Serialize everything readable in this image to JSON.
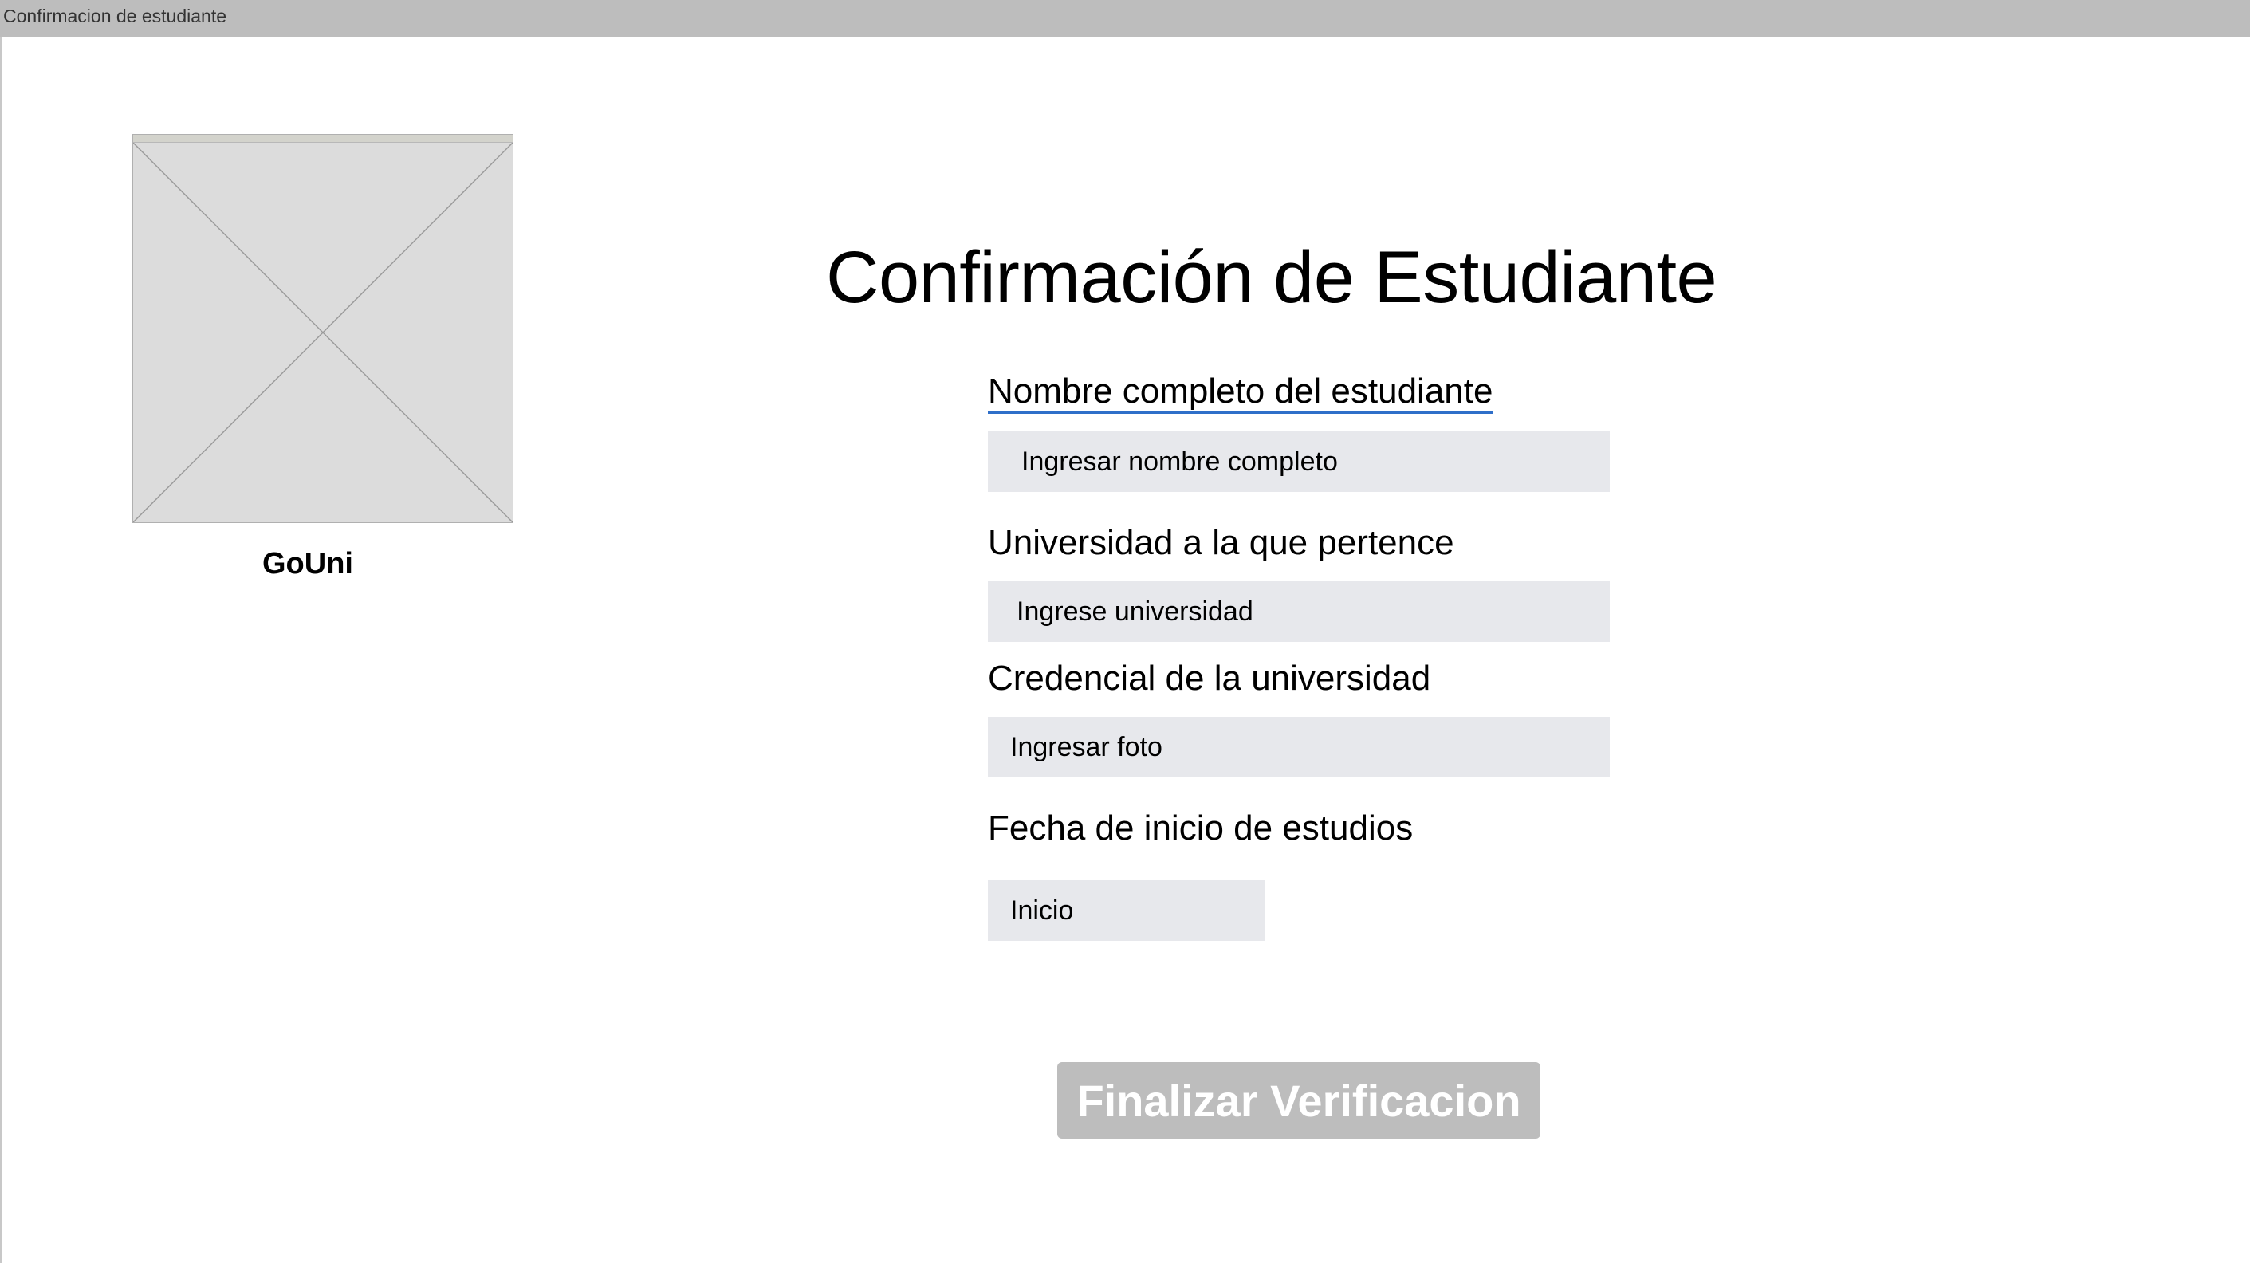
{
  "window": {
    "title": "Confirmacion de estudiante"
  },
  "brand": {
    "name": "GoUni",
    "logo_icon": "image-placeholder-icon"
  },
  "form": {
    "title": "Confirmación de Estudiante",
    "fields": [
      {
        "label": "Nombre completo del estudiante",
        "placeholder": "Ingresar nombre completo"
      },
      {
        "label": "Universidad a la que pertence",
        "placeholder": "Ingrese universidad"
      },
      {
        "label": "Credencial de la universidad",
        "placeholder": "Ingresar foto"
      },
      {
        "label": "Fecha de inicio de estudios",
        "placeholder": "Inicio"
      }
    ],
    "submit_label": "Finalizar Verificacion"
  },
  "colors": {
    "titlebar": "#bdbdbd",
    "input_background": "#e7e8ec",
    "button_disabled": "#bdbdbd",
    "spellcheck_underline": "#2f6fc9"
  }
}
